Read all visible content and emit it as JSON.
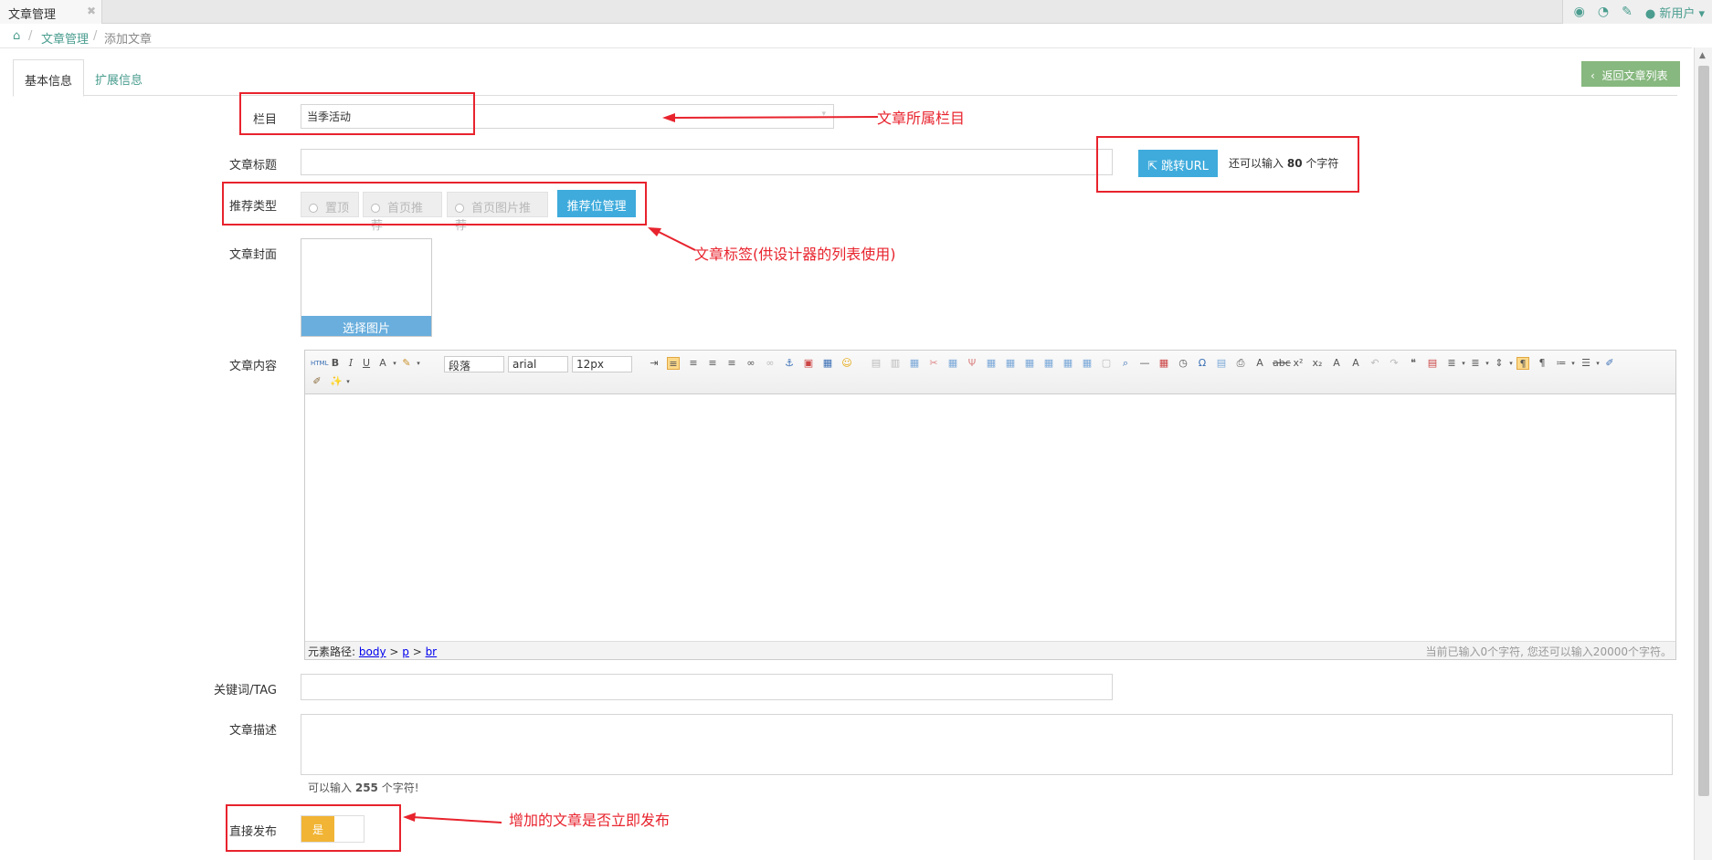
{
  "topbar": {
    "tab_label": "文章管理",
    "tab_close": "✖",
    "user_label": "新用户"
  },
  "breadcrumb": {
    "home_icon": "home-icon",
    "sep": "/",
    "item1": "文章管理",
    "item2": "添加文章"
  },
  "tabs": {
    "basic": "基本信息",
    "ext": "扩展信息"
  },
  "back_button": "返回文章列表",
  "form": {
    "column_label": "栏目",
    "column_value": "当季活动",
    "title_label": "文章标题",
    "jump_url": "跳转URL",
    "remain_prefix": "还可以输入",
    "remain_num": "80",
    "remain_suffix": "个字符",
    "recommend_label": "推荐类型",
    "rec_options": [
      "置顶",
      "首页推荐",
      "首页图片推荐"
    ],
    "rec_manage": "推荐位管理",
    "cover_label": "文章封面",
    "cover_select": "选择图片",
    "content_label": "文章内容",
    "keyword_label": "关键词/TAG",
    "desc_label": "文章描述",
    "desc_hint_prefix": "可以输入",
    "desc_hint_num": "255",
    "desc_hint_suffix": "个字符!",
    "publish_label": "直接发布",
    "publish_on": "是"
  },
  "editor": {
    "format": "段落",
    "font": "arial",
    "size": "12px",
    "path_label": "元素路径:",
    "path": [
      "body",
      "p",
      "br"
    ],
    "count_text": "当前已输入0个字符, 您还可以输入20000个字符。"
  },
  "annotations": {
    "a1": "文章所属栏目",
    "a2": "文章标签(供设计器的列表使用)",
    "a3": "增加的文章是否立即发布"
  },
  "colors": {
    "accent": "#4a9d8f",
    "annotation": "#e8232d",
    "blue_btn": "#3eabdc",
    "back_btn": "#87b87f",
    "toggle_on": "#f1b434"
  }
}
